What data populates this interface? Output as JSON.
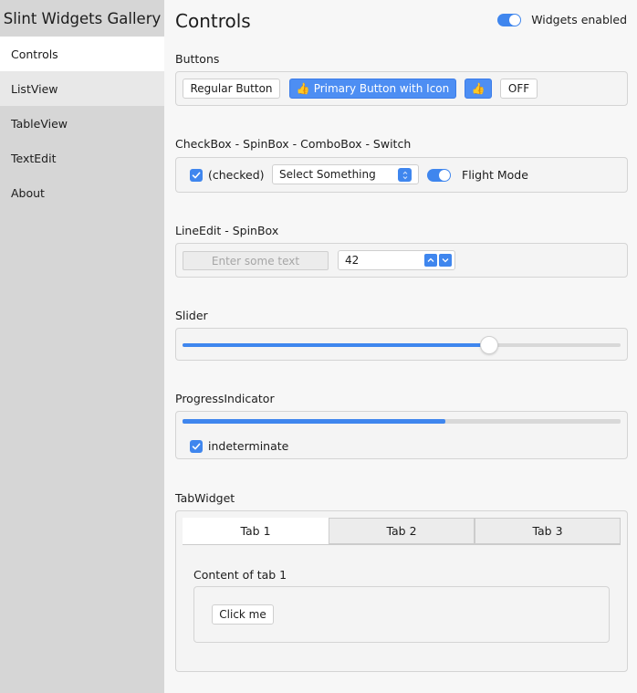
{
  "app": {
    "title": "Slint Widgets Gallery"
  },
  "sidebar": {
    "items": [
      {
        "label": "Controls"
      },
      {
        "label": "ListView"
      },
      {
        "label": "TableView"
      },
      {
        "label": "TextEdit"
      },
      {
        "label": "About"
      }
    ],
    "selected": "Controls"
  },
  "header": {
    "title": "Controls",
    "widgets_enabled": {
      "label": "Widgets enabled",
      "checked": true
    }
  },
  "buttons_section": {
    "title": "Buttons",
    "regular_label": "Regular Button",
    "primary_icon": "👍",
    "primary_label": "Primary Button with Icon",
    "icon_button_glyph": "👍",
    "toggle_label": "OFF"
  },
  "checkbox_section": {
    "title": "CheckBox - SpinBox - ComboBox - Switch",
    "checkbox_label": "(checked)",
    "checkbox_checked": true,
    "combo_value": "Select Something",
    "switch_label": "Flight Mode",
    "switch_checked": true
  },
  "lineedit_section": {
    "title": "LineEdit - SpinBox",
    "lineedit_placeholder": "Enter some text",
    "spinbox_value": "42"
  },
  "slider_section": {
    "title": "Slider",
    "value": 0.7
  },
  "progress_section": {
    "title": "ProgressIndicator",
    "progress": 0.6,
    "checkbox_label": "indeterminate",
    "checkbox_checked": true
  },
  "tab_section": {
    "title": "TabWidget",
    "tabs": [
      {
        "label": "Tab 1"
      },
      {
        "label": "Tab 2"
      },
      {
        "label": "Tab 3"
      }
    ],
    "selected_tab": "Tab 1",
    "content_label": "Content of tab 1",
    "button_label": "Click me"
  },
  "colors": {
    "accent": "#3f86ee",
    "sidebar_bg": "#d6d6d6",
    "main_bg": "#f7f7f7"
  },
  "icons": [
    "checkmark-icon",
    "thumbs-up-icon",
    "combo-arrows-icon",
    "spin-up-icon",
    "spin-down-icon"
  ]
}
